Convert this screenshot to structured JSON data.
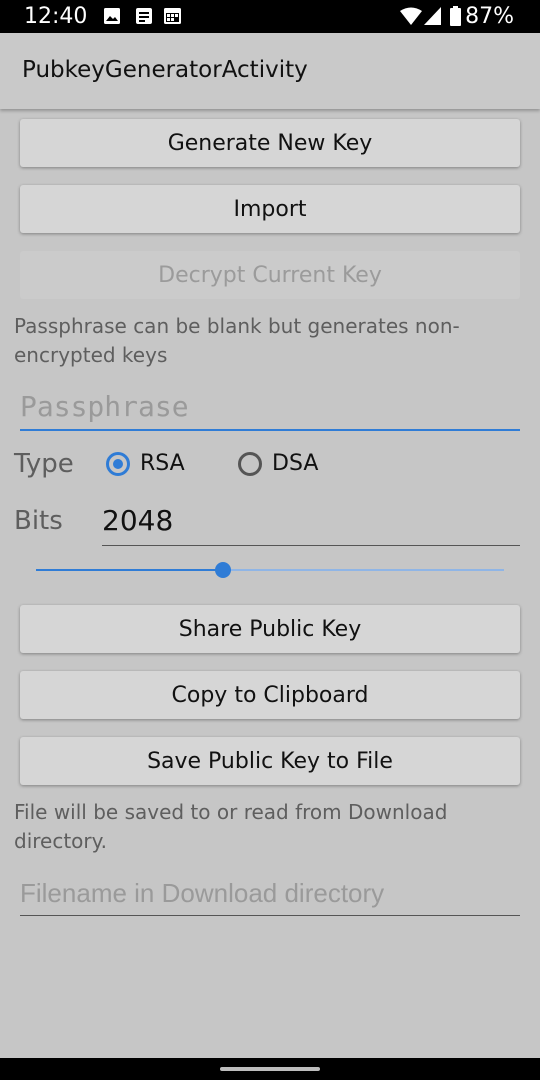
{
  "status_bar": {
    "time": "12:40",
    "battery_pct": "87%",
    "icons": [
      "image-icon",
      "message-icon",
      "calendar-icon",
      "wifi-icon",
      "signal-icon",
      "battery-icon"
    ]
  },
  "app_bar": {
    "title": "PubkeyGeneratorActivity"
  },
  "buttons": {
    "generate": "Generate New Key",
    "import": "Import",
    "decrypt": "Decrypt Current Key",
    "share": "Share Public Key",
    "copy": "Copy to Clipboard",
    "save": "Save Public Key to File"
  },
  "passphrase": {
    "hint": "Passphrase can be blank but generates non-encrypted keys",
    "placeholder": "Passphrase",
    "value": ""
  },
  "type": {
    "label": "Type",
    "options": [
      {
        "label": "RSA",
        "selected": true
      },
      {
        "label": "DSA",
        "selected": false
      }
    ]
  },
  "bits": {
    "label": "Bits",
    "value": "2048",
    "slider_fraction": 0.4
  },
  "file": {
    "hint": "File will be saved to or read from Download directory.",
    "placeholder": "Filename in Download directory",
    "value": ""
  },
  "colors": {
    "accent": "#2f7cd6",
    "background": "#c6c6c6",
    "button": "#d6d6d6"
  }
}
